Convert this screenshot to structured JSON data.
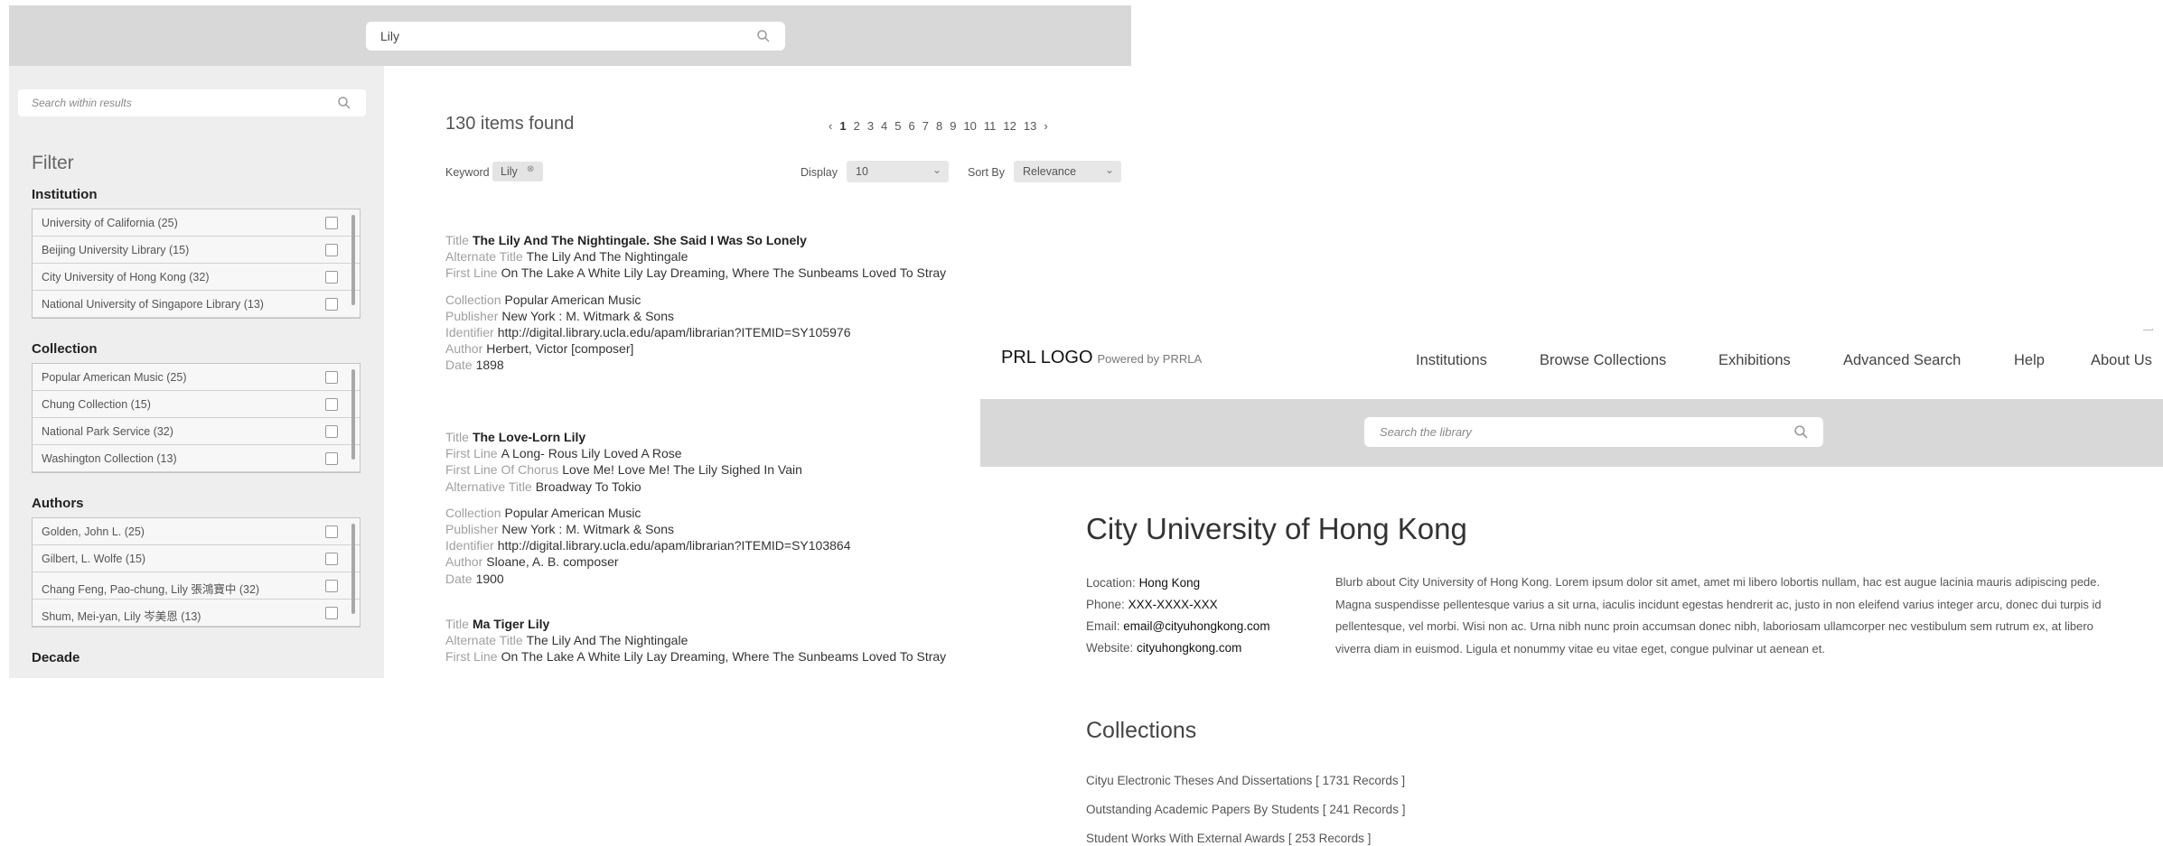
{
  "results_page": {
    "top_search": {
      "value": "Lily",
      "icon": "search-icon"
    },
    "sidebar": {
      "search": {
        "placeholder": "Search within results",
        "icon": "search-icon"
      },
      "filter_title": "Filter",
      "groups": [
        {
          "title": "Institution",
          "items": [
            {
              "label": "University of California (25)"
            },
            {
              "label": "Beijing University Library (15)"
            },
            {
              "label": "City University of Hong Kong (32)"
            },
            {
              "label": "National University of Singapore Library (13)"
            }
          ]
        },
        {
          "title": "Collection",
          "items": [
            {
              "label": "Popular American Music (25)"
            },
            {
              "label": "Chung Collection (15)"
            },
            {
              "label": "National Park Service (32)"
            },
            {
              "label": "Washington Collection (13)"
            }
          ]
        },
        {
          "title": "Authors",
          "items": [
            {
              "label": "Golden, John L.  (25)"
            },
            {
              "label": "Gilbert, L. Wolfe  (15)"
            },
            {
              "label": "Chang Feng, Pao-chung, Lily 張鴻寶中 (32)"
            },
            {
              "label": "Shum, Mei-yan, Lily 岑美恩 (13)"
            }
          ]
        },
        {
          "title": "Decade",
          "items": []
        }
      ]
    },
    "summary": {
      "count_text": "130 items found"
    },
    "pagination": {
      "prev": "‹",
      "pages": [
        "1",
        "2",
        "3",
        "4",
        "5",
        "6",
        "7",
        "8",
        "9",
        "10",
        "11",
        "12",
        "13"
      ],
      "current": "1",
      "next": "›"
    },
    "controls": {
      "keyword_label": "Keyword",
      "keyword_chip": "Lily",
      "keyword_chip_icon": "remove-icon",
      "display_label": "Display",
      "display_value": "10",
      "sort_label": "Sort By",
      "sort_value": "Relevance"
    },
    "records": [
      {
        "fields": [
          {
            "k": "Title",
            "v": "The Lily And The Nightingale. She Said I Was So Lonely",
            "title": true
          },
          {
            "k": "Alternate Title",
            "v": "The Lily And The Nightingale"
          },
          {
            "k": "First Line",
            "v": "On The Lake A White Lily Lay Dreaming, Where The Sunbeams Loved To Stray"
          },
          {
            "gap": true
          },
          {
            "k": "Collection",
            "v": "Popular American Music"
          },
          {
            "k": "Publisher",
            "v": "New York : M. Witmark & Sons"
          },
          {
            "k": "Identifier",
            "v": "http://digital.library.ucla.edu/apam/librarian?ITEMID=SY105976"
          },
          {
            "k": "Author",
            "v": "Herbert, Victor [composer]"
          },
          {
            "k": "Date",
            "v": "1898"
          }
        ]
      },
      {
        "fields": [
          {
            "k": "Title",
            "v": "The Love-Lorn Lily",
            "title": true
          },
          {
            "k": "First Line",
            "v": "A Long- Rous Lily Loved A Rose"
          },
          {
            "k": "First Line Of Chorus",
            "v": "Love Me! Love Me! The Lily Sighed In Vain"
          },
          {
            "k": "Alternative Title",
            "v": "Broadway To Tokio"
          },
          {
            "gap": true
          },
          {
            "k": "Collection",
            "v": "Popular American Music"
          },
          {
            "k": "Publisher",
            "v": "New York : M. Witmark & Sons"
          },
          {
            "k": "Identifier",
            "v": "http://digital.library.ucla.edu/apam/librarian?ITEMID=SY103864"
          },
          {
            "k": "Author",
            "v": "Sloane, A. B. composer"
          },
          {
            "k": "Date",
            "v": "1900"
          }
        ]
      },
      {
        "fields": [
          {
            "k": "Title",
            "v": "Ma Tiger Lily",
            "title": true
          },
          {
            "k": "Alternate Title",
            "v": "The Lily And The Nightingale"
          },
          {
            "k": "First Line",
            "v": "On The Lake A White Lily Lay Dreaming, Where The Sunbeams Loved To Stray"
          }
        ]
      }
    ]
  },
  "institution_page": {
    "logo": "PRL LOGO",
    "powered_by": "Powered by PRRLA",
    "nav": [
      "Institutions",
      "Browse Collections",
      "Exhibitions",
      "Advanced Search",
      "Help",
      "About Us"
    ],
    "search": {
      "placeholder": "Search the library",
      "icon": "search-icon"
    },
    "title": "City University of Hong Kong",
    "contact": [
      {
        "label": "Location:",
        "value": "Hong Kong"
      },
      {
        "label": "Phone:",
        "value": "XXX-XXXX-XXX"
      },
      {
        "label": "Email:",
        "value": "email@cityuhongkong.com"
      },
      {
        "label": "Website:",
        "value": "cityuhongkong.com"
      }
    ],
    "blurb": "Blurb about City University of Hong Kong. Lorem ipsum dolor sit amet, amet mi libero lobortis nullam, hac est augue lacinia mauris adipiscing pede. Magna suspendisse pellentesque varius a sit urna, iaculis incidunt egestas hendrerit ac, justo in non eleifend varius integer arcu, donec dui turpis id pellentesque, vel morbi. Wisi non ac. Urna nibh nunc proin accumsan donec nibh, laboriosam ullamcorper nec vestibulum sem rutrum ex, at libero viverra diam in euismod. Ligula et nonummy vitae eu vitae eget, congue pulvinar ut aenean et.",
    "collections_title": "Collections",
    "collections": [
      "Cityu Electronic Theses And Dissertations [ 1731 Records ]",
      "Outstanding Academic Papers By Students [ 241 Records ]",
      "Student Works With External Awards [ 253 Records ]"
    ]
  }
}
